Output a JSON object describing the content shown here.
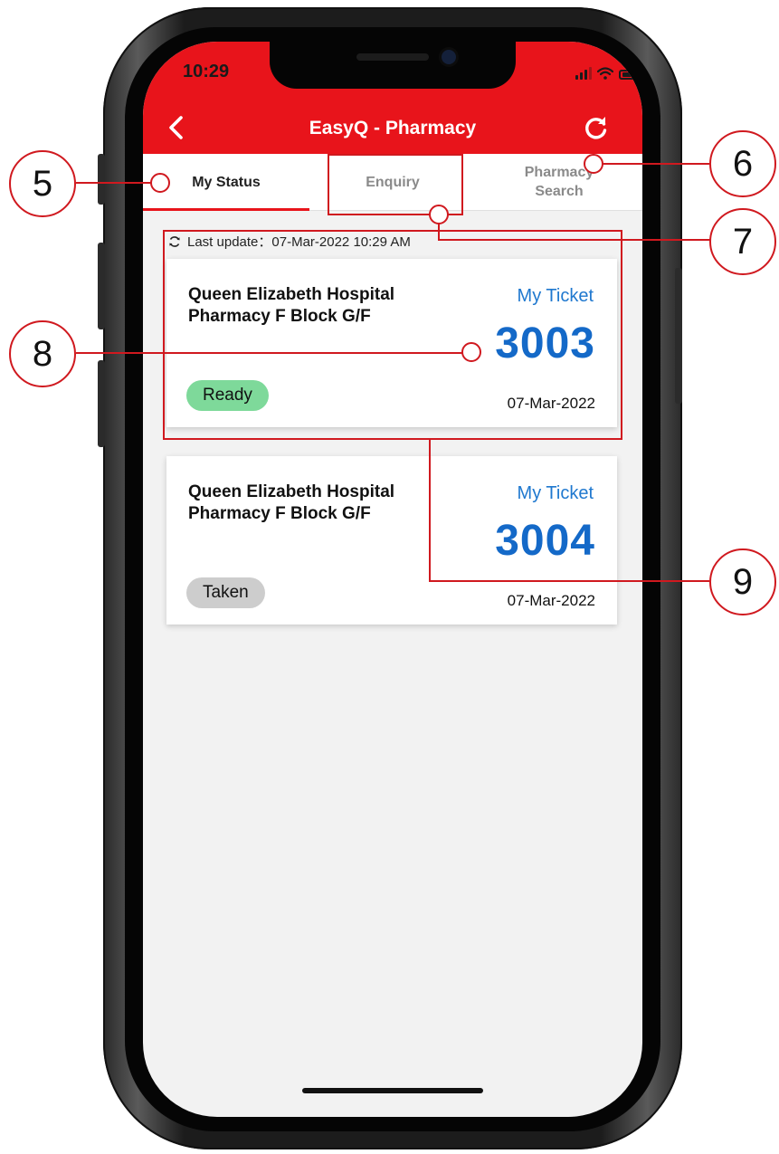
{
  "status_bar": {
    "time": "10:29"
  },
  "header": {
    "title": "EasyQ - Pharmacy",
    "back_icon": "chevron-left-icon",
    "refresh_icon": "refresh-icon"
  },
  "tabs": [
    {
      "label": "My Status",
      "active": true
    },
    {
      "label": "Enquiry",
      "active": false
    },
    {
      "label": "Pharmacy\nSearch",
      "active": false
    }
  ],
  "last_update": {
    "icon": "sync-icon",
    "text": "Last update：07-Mar-2022 10:29 AM"
  },
  "tickets": [
    {
      "location": "Queen Elizabeth Hospital Pharmacy F Block G/F",
      "label": "My Ticket",
      "number": "3003",
      "status": "Ready",
      "status_color": "#7ed99a",
      "date": "07-Mar-2022"
    },
    {
      "location": "Queen Elizabeth Hospital Pharmacy F Block G/F",
      "label": "My Ticket",
      "number": "3004",
      "status": "Taken",
      "status_color": "#cdcdcd",
      "date": "07-Mar-2022"
    }
  ],
  "annotations": {
    "c5": "5",
    "c6": "6",
    "c7": "7",
    "c8": "8",
    "c9": "9",
    "color": "#d0191f"
  },
  "colors": {
    "brand": "#e8141b",
    "ticket_blue": "#1469c8"
  }
}
